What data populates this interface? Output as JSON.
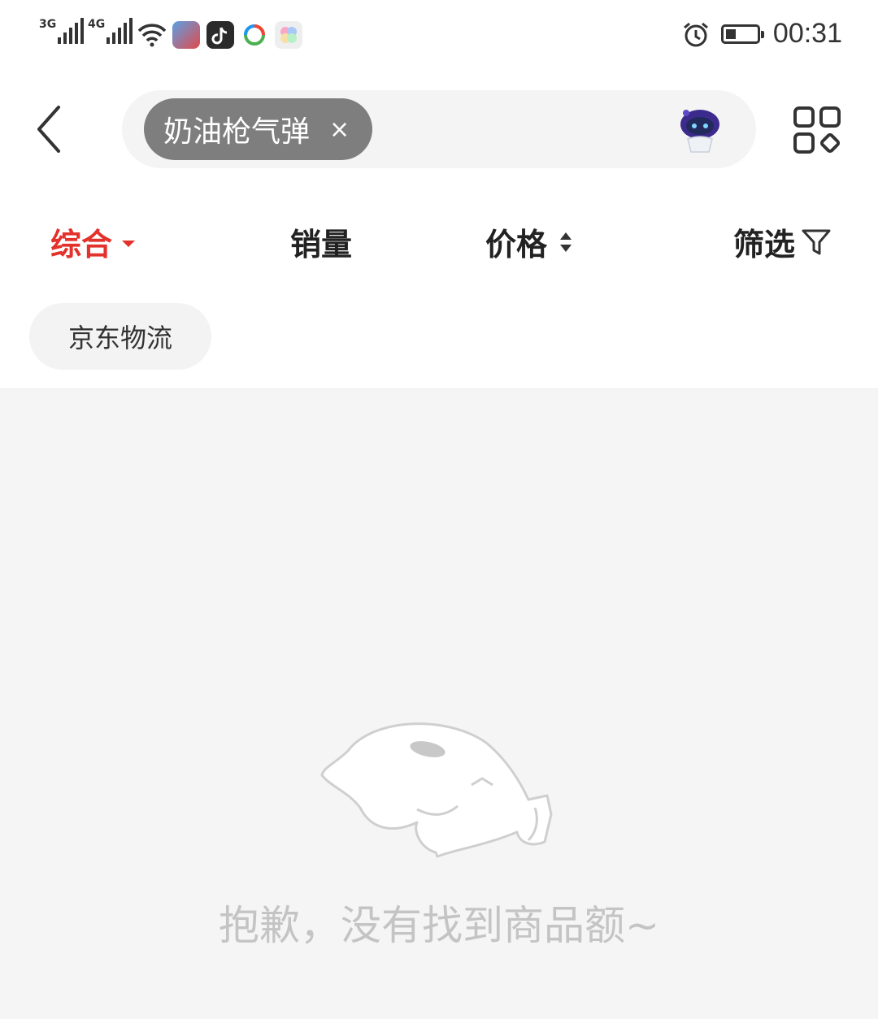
{
  "status_bar": {
    "net1": "3G",
    "net2": "4G",
    "time": "00:31",
    "icons": [
      "wifi-icon",
      "game-app-icon",
      "tiktok-app-icon",
      "browser-app-icon",
      "gallery-app-icon",
      "alarm-icon",
      "battery-icon"
    ]
  },
  "header": {
    "search_chip": "奶油枪气弹",
    "chip_close": "×"
  },
  "sort_bar": {
    "tabs": [
      "综合",
      "销量",
      "价格",
      "筛选"
    ],
    "active_color": "#e3312b"
  },
  "filters": {
    "jd_logistics": "京东物流"
  },
  "empty_state": {
    "message": "抱歉，没有找到商品额~"
  },
  "colors": {
    "accent": "#e3312b",
    "chip_bg": "#7e7e7e",
    "page_bg": "#f5f5f6"
  }
}
